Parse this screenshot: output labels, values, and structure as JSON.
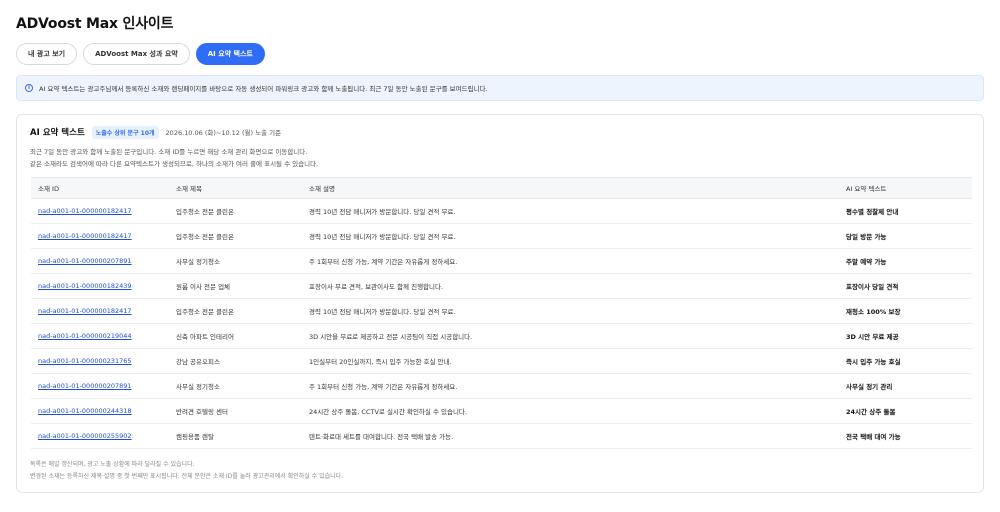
{
  "page": {
    "title": "ADVoost Max 인사이트"
  },
  "tabs": [
    {
      "label": "내 광고 보기",
      "active": false
    },
    {
      "label": "ADVoost Max 성과 요약",
      "active": false
    },
    {
      "label": "AI 요약 텍스트",
      "active": true
    }
  ],
  "banner": {
    "icon": "info-icon",
    "text": "AI 요약 텍스트는 광고주님께서 등록하신 소재와 랜딩페이지를 바탕으로 자동 생성되어 파워링크 광고와 함께 노출됩니다. 최근 7일 동안 노출된 문구를 보여드립니다."
  },
  "card": {
    "title": "AI 요약 텍스트",
    "badge": "노출수 상위 문구 10개",
    "period": "2026.10.06 (화)~10.12 (월) 노출 기준",
    "desc_1": "최근 7일 동안 광고와 함께 노출된 문구입니다. 소재 ID를 누르면 해당 소재 관리 화면으로 이동합니다.",
    "desc_2": "같은 소재라도 검색어에 따라 다른 요약텍스트가 생성되므로, 하나의 소재가 여러 줄에 표시될 수 있습니다."
  },
  "table": {
    "headers": [
      "소재 ID",
      "소재 제목",
      "소재 설명",
      "AI 요약 텍스트"
    ],
    "rows": [
      {
        "id": "nad-a001-01-000000182417",
        "title": "입주청소 전문 클린온",
        "desc": "경력 10년 전담 매니저가 방문합니다. 당일 견적 무료.",
        "summary": "평수별 정찰제 안내"
      },
      {
        "id": "nad-a001-01-000000182417",
        "title": "입주청소 전문 클린온",
        "desc": "경력 10년 전담 매니저가 방문합니다. 당일 견적 무료.",
        "summary": "당일 방문 가능"
      },
      {
        "id": "nad-a001-01-000000207891",
        "title": "사무실 정기청소",
        "desc": "주 1회부터 신청 가능, 계약 기간은 자유롭게 정하세요.",
        "summary": "주말 예약 가능"
      },
      {
        "id": "nad-a001-01-000000182439",
        "title": "원룸 이사 전문 업체",
        "desc": "포장이사 무료 견적, 보관이사도 함께 진행합니다.",
        "summary": "포장이사 당일 견적"
      },
      {
        "id": "nad-a001-01-000000182417",
        "title": "입주청소 전문 클린온",
        "desc": "경력 10년 전담 매니저가 방문합니다. 당일 견적 무료.",
        "summary": "재청소 100% 보장"
      },
      {
        "id": "nad-a001-01-000000219044",
        "title": "신축 아파트 인테리어",
        "desc": "3D 시안을 무료로 제공하고 전문 시공팀이 직접 시공합니다.",
        "summary": "3D 시안 무료 제공"
      },
      {
        "id": "nad-a001-01-000000231765",
        "title": "강남 공유오피스",
        "desc": "1인실부터 20인실까지, 즉시 입주 가능한 호실 안내.",
        "summary": "즉시 입주 가능 호실"
      },
      {
        "id": "nad-a001-01-000000207891",
        "title": "사무실 정기청소",
        "desc": "주 1회부터 신청 가능, 계약 기간은 자유롭게 정하세요.",
        "summary": "사무실 정기 관리"
      },
      {
        "id": "nad-a001-01-000000244318",
        "title": "반려견 호텔링 센터",
        "desc": "24시간 상주 돌봄, CCTV로 실시간 확인하실 수 있습니다.",
        "summary": "24시간 상주 돌봄"
      },
      {
        "id": "nad-a001-01-000000255902",
        "title": "캠핑용품 렌탈",
        "desc": "텐트·화로대 세트를 대여합니다. 전국 택배 발송 가능.",
        "summary": "전국 택배 대여 가능"
      }
    ]
  },
  "footer": {
    "note_1": "목록은 매일 갱신되며, 광고 노출 상황에 따라 달라질 수 있습니다.",
    "note_2": "변경된 소재는 등록하신 제목·설명 중 첫 번째만 표시됩니다. 전체 문안은 소재 ID를 눌러 광고관리에서 확인하실 수 있습니다."
  }
}
